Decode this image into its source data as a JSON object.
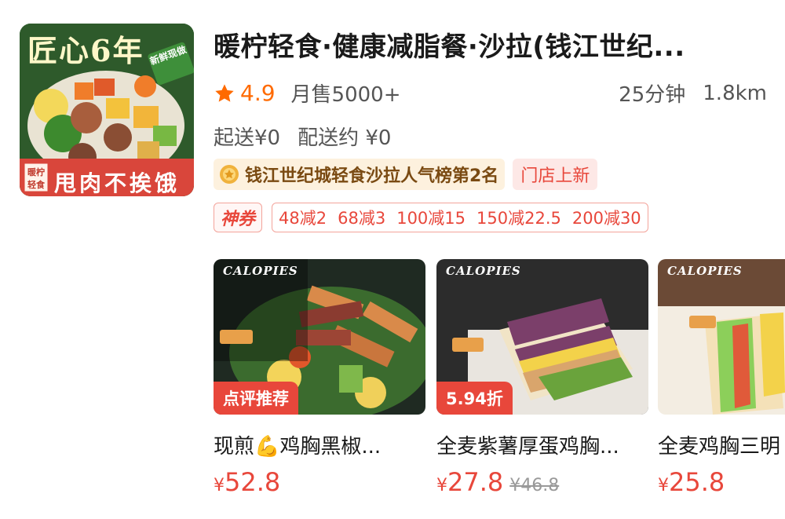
{
  "store": {
    "name": "暖柠轻食·健康减脂餐·沙拉(钱江世纪...",
    "logo_text_top": "匠心6年",
    "logo_badge": "新鲜现做",
    "logo_slogan": "甩肉不挨饿",
    "logo_brand": "暖柠轻食",
    "rating": "4.9",
    "sales": "月售5000+",
    "eta": "25分钟",
    "distance": "1.8km",
    "min_order": "起送¥0",
    "delivery_fee": "配送约 ¥0",
    "rank_badge": "钱江世纪城轻食沙拉人气榜第2名",
    "new_tag": "门店上新",
    "coupon_label": "神券",
    "coupons": [
      "48减2",
      "68减3",
      "100减15",
      "150减22.5",
      "200减30"
    ]
  },
  "dishes": [
    {
      "brand": "CALOPIES",
      "tag": "点评推荐",
      "name": "现煎💪鸡胸黑椒...",
      "price_symbol": "¥",
      "price": "52.8",
      "old_price": ""
    },
    {
      "brand": "CALOPIES",
      "tag": "5.94折",
      "name": "全麦紫薯厚蛋鸡胸...",
      "price_symbol": "¥",
      "price": "27.8",
      "old_price": "¥46.8"
    },
    {
      "brand": "CALOPIES",
      "tag": "",
      "name": "全麦鸡胸三明",
      "price_symbol": "¥",
      "price": "25.8",
      "old_price": ""
    }
  ],
  "colors": {
    "accent": "#e8473b",
    "rating": "#ff6a00",
    "badge_bg": "#fdf1de"
  },
  "icons": [
    "star-icon",
    "medal-icon"
  ]
}
